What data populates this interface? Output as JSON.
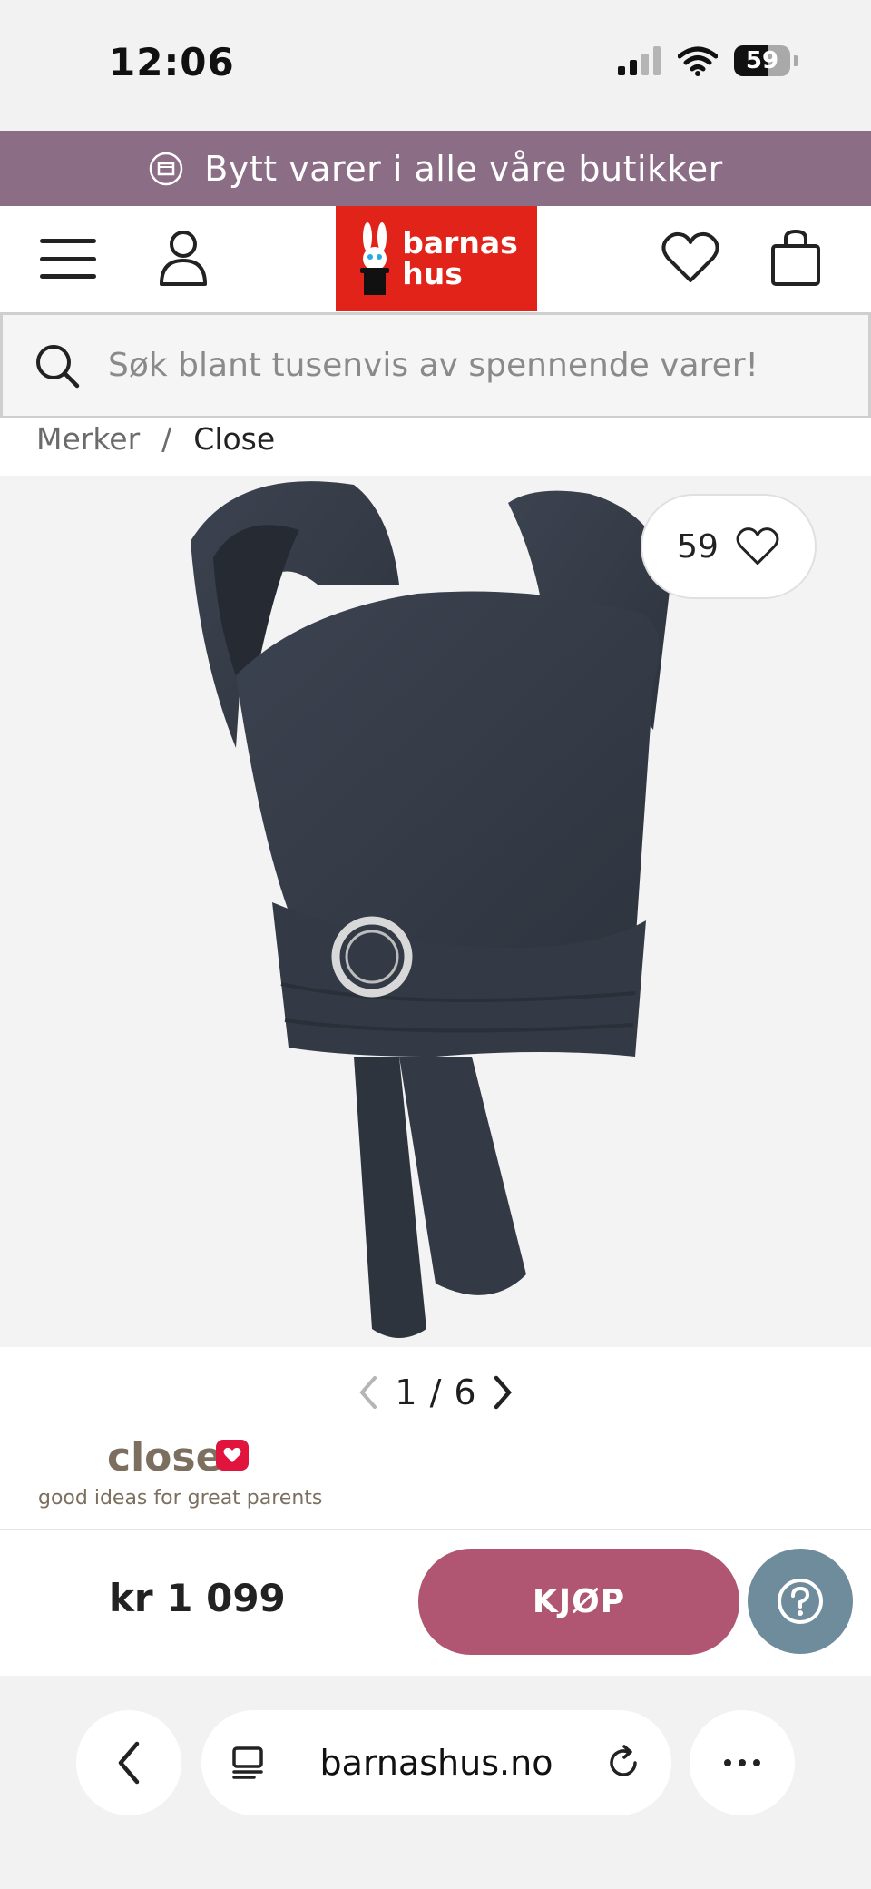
{
  "status_bar": {
    "time": "12:06",
    "battery": "59",
    "battery_level": 0.59
  },
  "promo": {
    "text": "Bytt varer i alle våre butikker",
    "icon": "exchange-box-icon"
  },
  "header": {
    "logo_line1": "barnas",
    "logo_line2": "hus",
    "brand_color": "#e2231a",
    "icons": [
      "menu-icon",
      "account-icon",
      "heart-icon",
      "shopping-bag-icon"
    ]
  },
  "search": {
    "placeholder": "Søk blant tusenvis av spennende varer!"
  },
  "breadcrumb": {
    "items": [
      "Merker",
      "Close"
    ],
    "separator": "/"
  },
  "gallery": {
    "favorite_count": "59",
    "current": "1",
    "separator": "/",
    "total": "6"
  },
  "brand": {
    "name": "close",
    "tagline": "good ideas for great parents"
  },
  "purchase": {
    "price": "kr 1 099",
    "buy_label": "KJØP",
    "buy_color": "#b05673",
    "help_color": "#6f8c9c"
  },
  "browser": {
    "url": "barnashus.no"
  }
}
